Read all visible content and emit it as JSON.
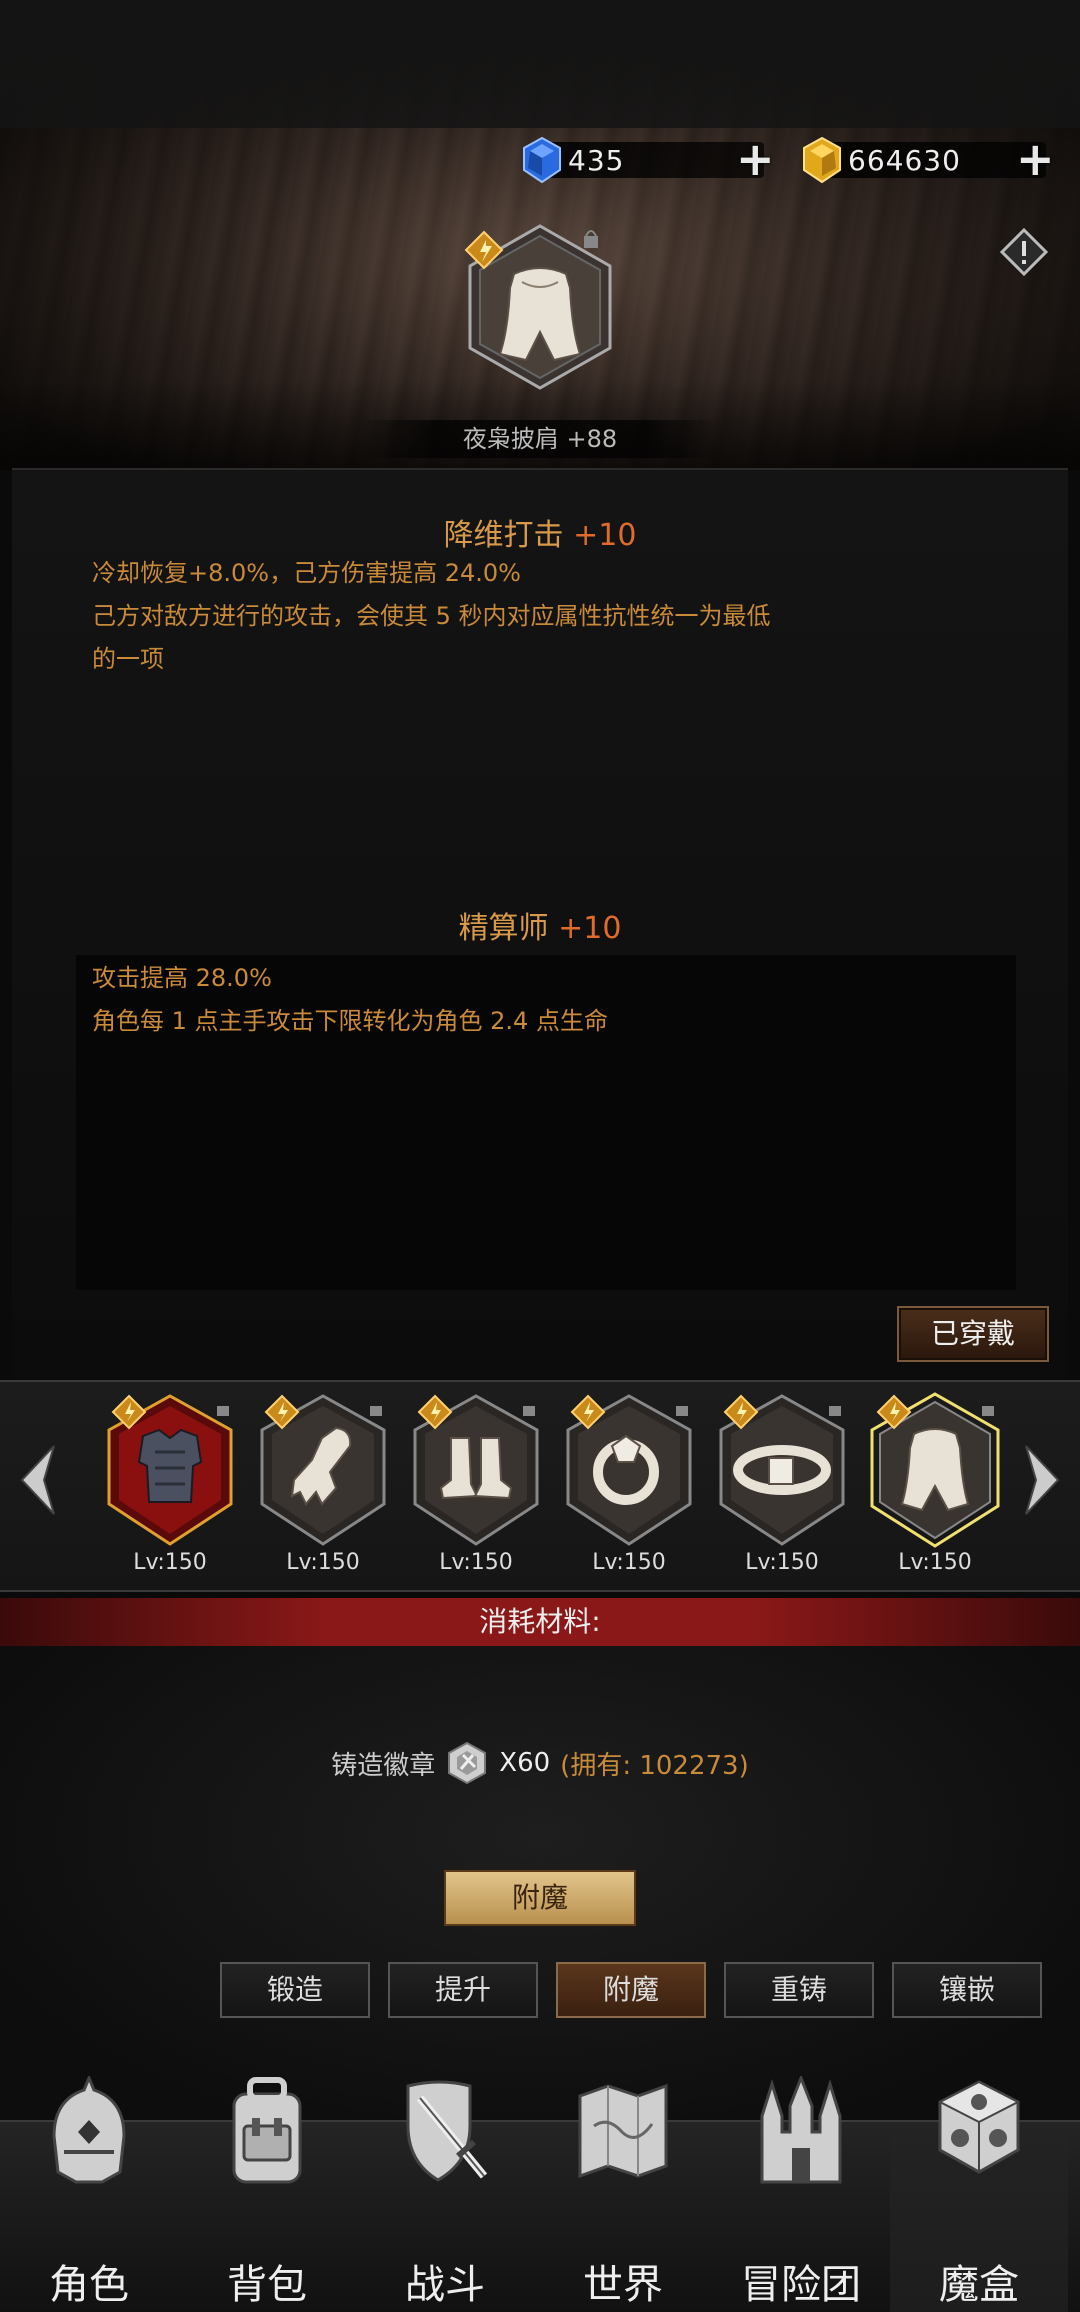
{
  "currency": {
    "gems": "435",
    "gold": "664630"
  },
  "item": {
    "name": "夜枭披肩 +88"
  },
  "skills": [
    {
      "title": "降维打击",
      "bonus": "+10",
      "lines": [
        "冷却恢复+8.0%，己方伤害提高 24.0%",
        "己方对敌方进行的攻击，会使其 5 秒内对应属性抗性统一为最低",
        "的一项"
      ]
    },
    {
      "title": "精算师",
      "bonus": "+10",
      "lines": [
        "攻击提高 28.0%",
        "角色每 1 点主手攻击下限转化为角色 2.4 点生命"
      ]
    }
  ],
  "equipped_label": "已穿戴",
  "equipment": [
    {
      "icon": "armor-icon",
      "level": "Lv:150",
      "selected": false,
      "red": true
    },
    {
      "icon": "gauntlet-icon",
      "level": "Lv:150"
    },
    {
      "icon": "boots-icon",
      "level": "Lv:150"
    },
    {
      "icon": "ring-icon",
      "level": "Lv:150"
    },
    {
      "icon": "belt-icon",
      "level": "Lv:150"
    },
    {
      "icon": "cape-icon",
      "level": "Lv:150",
      "selected": true
    }
  ],
  "materials": {
    "header": "消耗材料:",
    "name": "铸造徽章",
    "quantity": "X60",
    "owned": "(拥有: 102273)"
  },
  "enchant_button": "附魔",
  "tabs": [
    "锻造",
    "提升",
    "附魔",
    "重铸",
    "镶嵌"
  ],
  "active_tab": "附魔",
  "nav": [
    {
      "label": "角色",
      "icon": "helmet-icon"
    },
    {
      "label": "背包",
      "icon": "backpack-icon"
    },
    {
      "label": "战斗",
      "icon": "sword-shield-icon"
    },
    {
      "label": "世界",
      "icon": "map-icon"
    },
    {
      "label": "冒险团",
      "icon": "castle-icon"
    },
    {
      "label": "魔盒",
      "icon": "cube-icon"
    }
  ],
  "active_nav": "魔盒",
  "colors": {
    "accent": "#d89a4a",
    "bonus": "#e06b2a",
    "material_bar": "#8a1818"
  }
}
